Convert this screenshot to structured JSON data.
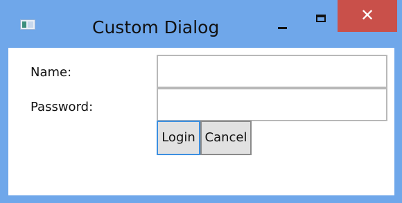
{
  "window": {
    "title": "Custom Dialog",
    "app_icon": "app-window-icon",
    "controls": {
      "minimize_icon": "minimize-icon",
      "maximize_icon": "maximize-icon",
      "close_symbol": "✕"
    },
    "frame_color": "#6fa7ea",
    "close_color": "#c9504a"
  },
  "form": {
    "name_label": "Name:",
    "name_value": "",
    "password_label": "Password:",
    "password_value": "",
    "login_label": "Login",
    "cancel_label": "Cancel",
    "focus_color": "#3c8fe0"
  }
}
